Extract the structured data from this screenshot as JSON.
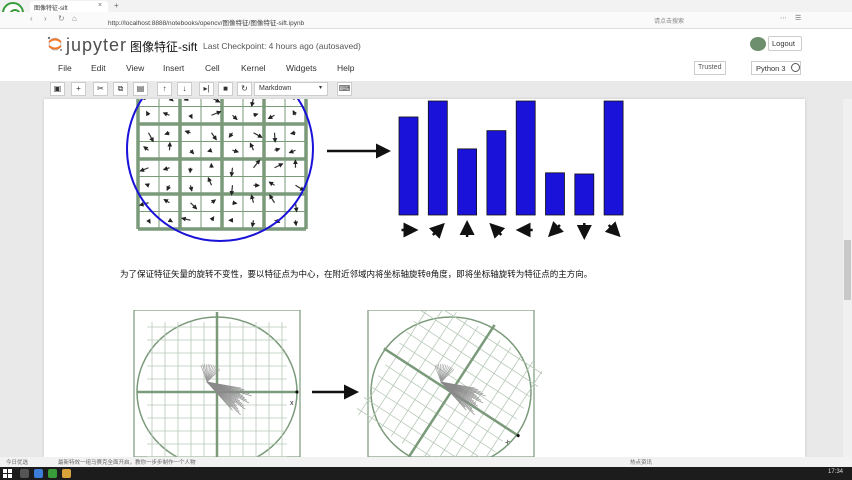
{
  "browser": {
    "tab_title": "图像特征-sift",
    "tab_close": "×",
    "new_tab": "+",
    "url": "http://localhost:8888/notebooks/opencv/图像特征/图像特征-sift.ipynb",
    "search_placeholder": "请点击搜索",
    "nav_back": "‹",
    "nav_forward": "›",
    "nav_reload": "↻",
    "nav_home": "⌂"
  },
  "header": {
    "logo_text": "jupyter",
    "notebook_title": "图像特征-sift",
    "checkpoint": "Last Checkpoint: 4 hours ago (autosaved)",
    "logout_label": "Logout"
  },
  "menu": {
    "items": [
      "File",
      "Edit",
      "View",
      "Insert",
      "Cell",
      "Kernel",
      "Widgets",
      "Help"
    ],
    "trusted_label": "Trusted",
    "kernel_label": "Python 3"
  },
  "toolbar": {
    "buttons": [
      "save",
      "add",
      "cut",
      "copy",
      "paste",
      "move-up",
      "move-down",
      "run",
      "interrupt",
      "restart"
    ],
    "cell_type": "Markdown",
    "chevron": "▾"
  },
  "cell": {
    "text": "为了保证特征矢量的旋转不变性，要以特征点为中心，在附近邻域内将坐标轴旋转θ角度，即将坐标轴旋转为特征点的主方向。"
  },
  "figure1": {
    "histogram_values": [
      0.86,
      1.0,
      0.58,
      0.74,
      1.0,
      0.37,
      0.36,
      1.0
    ],
    "bar_color": "#1a12d9",
    "direction_arrows": [
      "→",
      "↗",
      "↑",
      "↖",
      "←",
      "↙",
      "↓",
      "↘"
    ]
  },
  "figure2": {
    "axis_label": "x"
  },
  "statusbar": {
    "left": "今日优选",
    "mid": "最新特效一组马赛克全面开启，教你一步步制作一个人物",
    "right": "热点资讯"
  },
  "taskbar": {
    "clock": "17:34"
  },
  "colors": {
    "jupyter_orange": "#f37726",
    "grid_green": "#7a9a7a",
    "circle_blue": "#1a12d9"
  }
}
